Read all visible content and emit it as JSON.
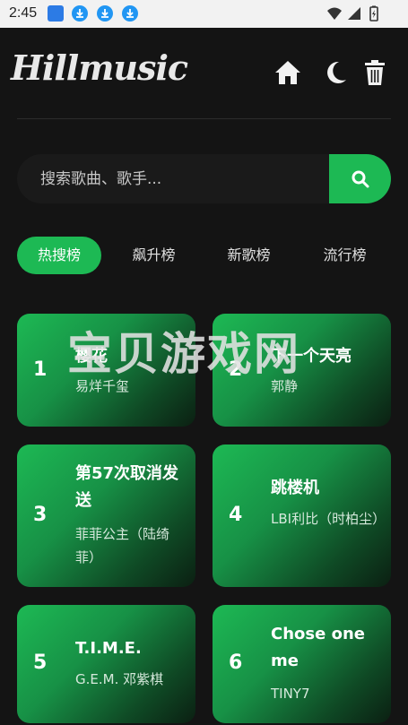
{
  "status_bar": {
    "time": "2:45"
  },
  "header": {
    "logo": "Hillmusic"
  },
  "search": {
    "placeholder": "搜索歌曲、歌手..."
  },
  "tabs": [
    {
      "label": "热搜榜",
      "active": true
    },
    {
      "label": "飙升榜",
      "active": false
    },
    {
      "label": "新歌榜",
      "active": false
    },
    {
      "label": "流行榜",
      "active": false
    }
  ],
  "songs": [
    {
      "rank": "1",
      "title": "樱花",
      "artist": "易烊千玺"
    },
    {
      "rank": "2",
      "title": "下一个天亮",
      "artist": "郭静"
    },
    {
      "rank": "3",
      "title": "第57次取消发送",
      "artist": "菲菲公主（陆绮菲）"
    },
    {
      "rank": "4",
      "title": "跳楼机",
      "artist": "LBI利比（时柏尘）"
    },
    {
      "rank": "5",
      "title": "T.I.M.E.",
      "artist": "G.E.M. 邓紫棋"
    },
    {
      "rank": "6",
      "title": "Chose one me",
      "artist": "TINY7"
    }
  ],
  "watermark": "宝贝游戏网",
  "colors": {
    "accent": "#1db954",
    "background": "#141414"
  }
}
